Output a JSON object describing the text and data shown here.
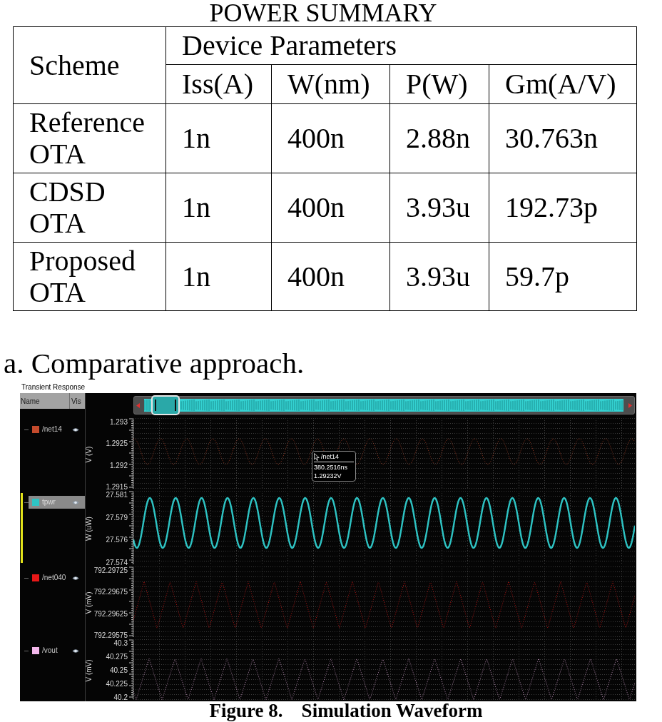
{
  "table_title": "POWER SUMMARY",
  "table": {
    "row_header": "Scheme",
    "group_header": "Device Parameters",
    "columns": [
      "Iss(A)",
      "W(nm)",
      "P(W)",
      "Gm(A/V)"
    ],
    "rows": [
      {
        "scheme": "Reference OTA",
        "values": [
          "1n",
          "400n",
          "2.88n",
          "30.763n"
        ]
      },
      {
        "scheme": "CDSD OTA",
        "values": [
          "1n",
          "400n",
          "3.93u",
          "192.73p"
        ]
      },
      {
        "scheme": "Proposed OTA",
        "values": [
          "1n",
          "400n",
          "3.93u",
          "59.7p"
        ]
      }
    ]
  },
  "caption": "a. Comparative approach.",
  "waveform_window": {
    "title": "Transient Response",
    "columns": [
      "Name",
      "Vis"
    ],
    "signals": [
      {
        "name": "/net14",
        "color": "#c44a2c",
        "selected": false,
        "axis_title": "V (V)",
        "ticks": [
          "1.293",
          "1.2925",
          "1.292",
          "1.2915"
        ],
        "readout": {
          "signal": "/net14",
          "time": "380.2516ns",
          "value": "1.29232V"
        }
      },
      {
        "name": "tpwr",
        "color": "#2ec4c4",
        "selected": true,
        "axis_title": "W (uW)",
        "ticks": [
          "27.581",
          "27.579",
          "27.576",
          "27.574"
        ]
      },
      {
        "name": "/net040",
        "color": "#e81818",
        "selected": false,
        "axis_title": "V (mV)",
        "ticks": [
          "792.29725",
          "792.29675",
          "792.29625",
          "792.29575"
        ]
      },
      {
        "name": "/vout",
        "color": "#f4b8ec",
        "selected": false,
        "axis_title": "V (mV)",
        "ticks": [
          "40.3",
          "40.275",
          "40.25",
          "40.225",
          "40.2"
        ]
      }
    ]
  },
  "figure_caption": {
    "label": "Figure 8.",
    "title": "Simulation Waveform"
  }
}
